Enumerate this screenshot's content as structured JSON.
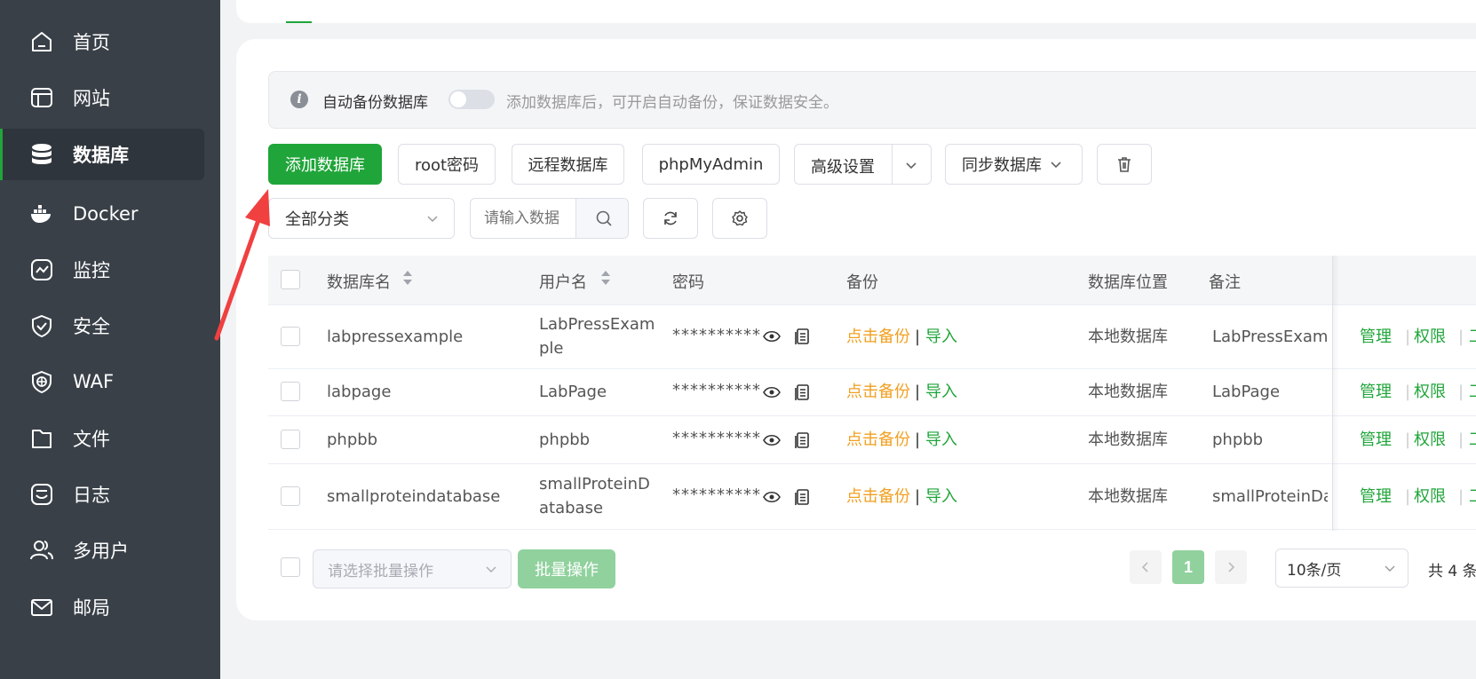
{
  "sidebar": {
    "items": [
      {
        "label": "首页",
        "icon": "home-icon"
      },
      {
        "label": "网站",
        "icon": "website-icon"
      },
      {
        "label": "数据库",
        "icon": "database-icon",
        "active": true
      },
      {
        "label": "Docker",
        "icon": "docker-icon"
      },
      {
        "label": "监控",
        "icon": "monitor-icon"
      },
      {
        "label": "安全",
        "icon": "shield-icon"
      },
      {
        "label": "WAF",
        "icon": "waf-icon"
      },
      {
        "label": "文件",
        "icon": "folder-icon"
      },
      {
        "label": "日志",
        "icon": "log-icon"
      },
      {
        "label": "多用户",
        "icon": "users-icon"
      },
      {
        "label": "邮局",
        "icon": "mail-icon"
      }
    ]
  },
  "info": {
    "auto_backup_label": "自动备份数据库",
    "hint": "添加数据库后，可开启自动备份，保证数据安全。",
    "auto_backup_on": false
  },
  "toolbar": {
    "add_db": "添加数据库",
    "root_pwd": "root密码",
    "remote_db": "远程数据库",
    "phpmyadmin": "phpMyAdmin",
    "advanced": "高级设置",
    "sync_db": "同步数据库",
    "category": "全部分类",
    "search_placeholder": "请输入数据"
  },
  "table": {
    "headers": {
      "name": "数据库名",
      "user": "用户名",
      "password": "密码",
      "backup": "备份",
      "location": "数据库位置",
      "note": "备注"
    },
    "rows": [
      {
        "name": "labpressexample",
        "user": "LabPressExam\nple",
        "password": "**********",
        "backup": "点击备份",
        "import": "导入",
        "location": "本地数据库",
        "note": "LabPressExamp",
        "manage": "管理",
        "perm": "权限",
        "more": "工"
      },
      {
        "name": "labpage",
        "user": "LabPage",
        "password": "**********",
        "backup": "点击备份",
        "import": "导入",
        "location": "本地数据库",
        "note": "LabPage",
        "manage": "管理",
        "perm": "权限",
        "more": "工"
      },
      {
        "name": "phpbb",
        "user": "phpbb",
        "password": "**********",
        "backup": "点击备份",
        "import": "导入",
        "location": "本地数据库",
        "note": "phpbb",
        "manage": "管理",
        "perm": "权限",
        "more": "工"
      },
      {
        "name": "smallproteindatabase",
        "user": "smallProteinD\natabase",
        "password": "**********",
        "backup": "点击备份",
        "import": "导入",
        "location": "本地数据库",
        "note": "smallProteinDat",
        "manage": "管理",
        "perm": "权限",
        "more": "工"
      }
    ]
  },
  "footer": {
    "batch_placeholder": "请选择批量操作",
    "batch_button": "批量操作",
    "page": "1",
    "page_size": "10条/页",
    "total": "共 4 条"
  },
  "colors": {
    "primary": "#20a53a",
    "sidebar": "#394048",
    "orange": "#f0a020"
  }
}
